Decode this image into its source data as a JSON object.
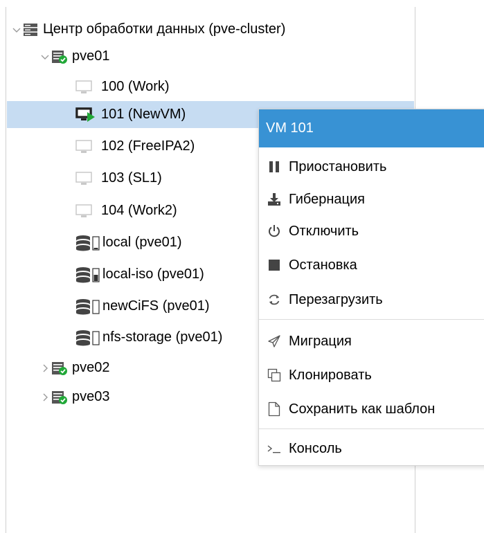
{
  "tree": {
    "datacenter": {
      "label": "Центр обработки данных (pve-cluster)",
      "icon": "server-rack-icon"
    },
    "nodes": [
      {
        "label": "pve01",
        "icon": "node-online-icon",
        "expanded": true
      },
      {
        "label": "pve02",
        "icon": "node-online-icon",
        "expanded": false
      },
      {
        "label": "pve03",
        "icon": "node-online-icon",
        "expanded": false
      }
    ],
    "pve01_children": [
      {
        "label": "100 (Work)",
        "icon": "vm-stopped-icon"
      },
      {
        "label": "101 (NewVM)",
        "icon": "vm-running-icon",
        "selected": true
      },
      {
        "label": "102 (FreeIPA2)",
        "icon": "vm-stopped-icon"
      },
      {
        "label": "103 (SL1)",
        "icon": "vm-stopped-icon"
      },
      {
        "label": "104 (Work2)",
        "icon": "vm-stopped-icon"
      },
      {
        "label": "local (pve01)",
        "icon": "storage-icon"
      },
      {
        "label": "local-iso (pve01)",
        "icon": "storage-icon"
      },
      {
        "label": "newCiFS (pve01)",
        "icon": "storage-icon"
      },
      {
        "label": "nfs-storage (pve01)",
        "icon": "storage-icon"
      }
    ]
  },
  "context_menu": {
    "title": "VM 101",
    "items": [
      {
        "label": "Приостановить",
        "icon": "pause-icon"
      },
      {
        "label": "Гибернация",
        "icon": "download-icon"
      },
      {
        "label": "Отключить",
        "icon": "power-icon"
      },
      {
        "label": "Остановка",
        "icon": "stop-icon"
      },
      {
        "label": "Перезагрузить",
        "icon": "refresh-icon"
      },
      {
        "label": "Миграция",
        "icon": "send-icon"
      },
      {
        "label": "Клонировать",
        "icon": "clone-icon"
      },
      {
        "label": "Сохранить как шаблон",
        "icon": "file-icon"
      },
      {
        "label": "Консоль",
        "icon": "terminal-icon"
      }
    ]
  },
  "colors": {
    "selection": "#c6dcf2",
    "menu_header": "#3892d4",
    "status_green": "#21a838"
  }
}
